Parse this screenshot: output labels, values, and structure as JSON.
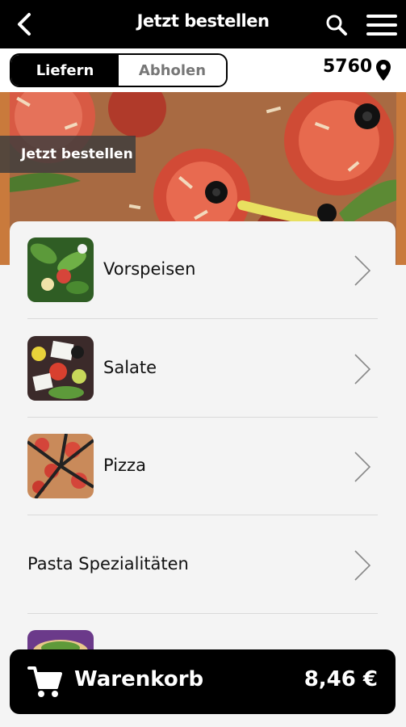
{
  "header": {
    "title": "Jetzt bestellen",
    "back_icon": "chevron-left-icon",
    "search_icon": "search-icon",
    "menu_icon": "hamburger-menu-icon"
  },
  "delivery": {
    "options": [
      {
        "label": "Liefern",
        "selected": true
      },
      {
        "label": "Abholen",
        "selected": false
      }
    ],
    "zip": "5760",
    "location_icon": "map-pin-icon"
  },
  "banner": {
    "label": "Jetzt bestellen"
  },
  "categories": [
    {
      "label": "Vorspeisen",
      "image": "salad-thumbnail",
      "has_image": true
    },
    {
      "label": "Salate",
      "image": "greek-salad-thumbnail",
      "has_image": true
    },
    {
      "label": "Pizza",
      "image": "pizza-thumbnail",
      "has_image": true
    },
    {
      "label": "Pasta Spezialitäten",
      "image": "",
      "has_image": false
    }
  ],
  "cart": {
    "label": "Warenkorb",
    "total": "8,46 €",
    "icon": "shopping-cart-icon"
  },
  "colors": {
    "bar": "#000000",
    "background": "#f4f4f4",
    "accent": "#c97a3c"
  }
}
